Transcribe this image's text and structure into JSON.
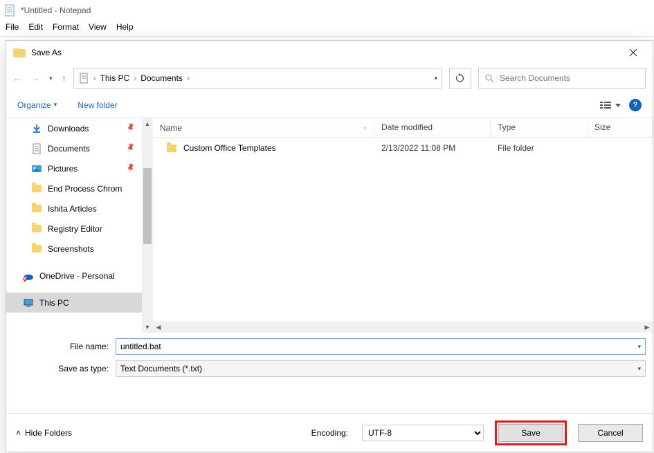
{
  "window": {
    "title": "*Untitled - Notepad"
  },
  "menu": [
    "File",
    "Edit",
    "Format",
    "View",
    "Help"
  ],
  "dialog": {
    "title": "Save As",
    "breadcrumb": [
      "This PC",
      "Documents"
    ],
    "search_placeholder": "Search Documents",
    "organize": "Organize",
    "new_folder": "New folder",
    "columns": {
      "name": "Name",
      "date": "Date modified",
      "type": "Type",
      "size": "Size"
    },
    "tree": [
      {
        "label": "Downloads",
        "icon": "download",
        "pinned": true
      },
      {
        "label": "Documents",
        "icon": "doc",
        "pinned": true
      },
      {
        "label": "Pictures",
        "icon": "pic",
        "pinned": true
      },
      {
        "label": "End Process Chrom",
        "icon": "folder"
      },
      {
        "label": "Ishita Articles",
        "icon": "folder"
      },
      {
        "label": "Registry Editor",
        "icon": "folder"
      },
      {
        "label": "Screenshots",
        "icon": "folder"
      },
      {
        "label": "OneDrive - Personal",
        "icon": "onedrive"
      },
      {
        "label": "This PC",
        "icon": "thispc",
        "active": true
      }
    ],
    "rows": [
      {
        "name": "Custom Office Templates",
        "date": "2/13/2022 11:08 PM",
        "type": "File folder",
        "size": ""
      }
    ],
    "file_name_label": "File name:",
    "file_name_value": "untitled.bat",
    "save_type_label": "Save as type:",
    "save_type_value": "Text Documents (*.txt)",
    "hide_folders": "Hide Folders",
    "encoding_label": "Encoding:",
    "encoding_value": "UTF-8",
    "save": "Save",
    "cancel": "Cancel"
  }
}
